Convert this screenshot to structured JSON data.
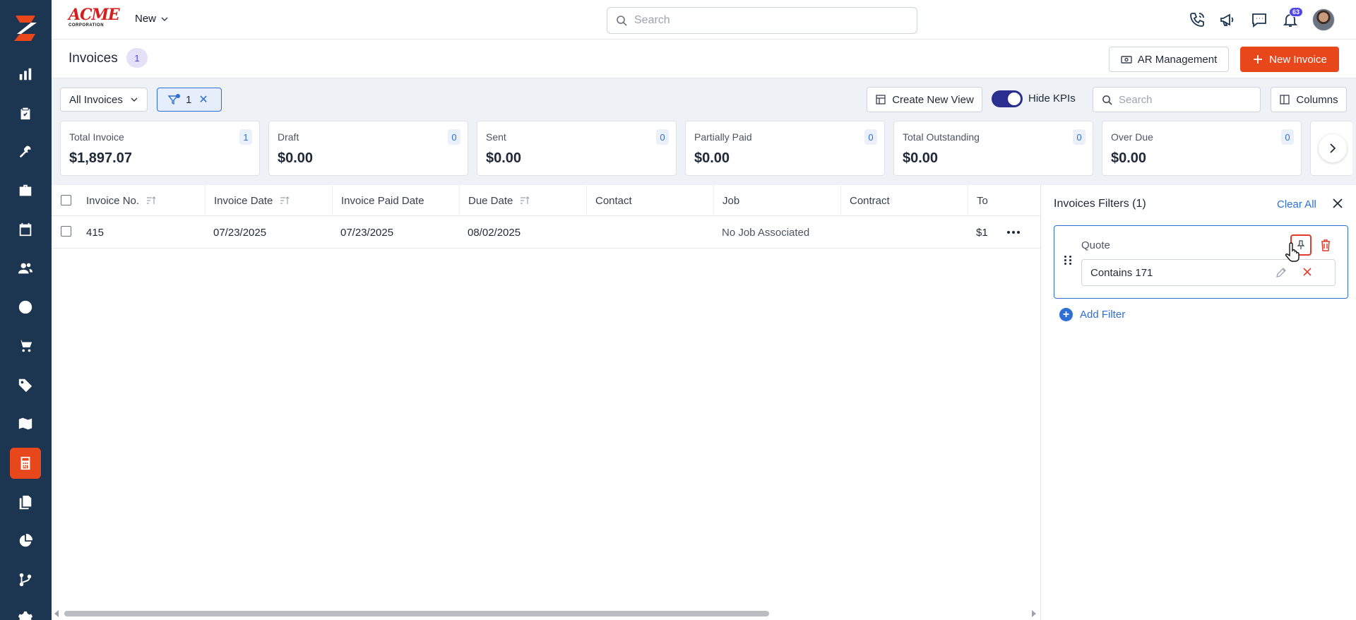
{
  "brand": {
    "name": "ACME",
    "sub": "CORPORATION"
  },
  "topbar": {
    "new_label": "New",
    "search_placeholder": "Search",
    "notifications_count": "63"
  },
  "page": {
    "title": "Invoices",
    "count": "1",
    "ar_button": "AR Management",
    "new_invoice_button": "New Invoice"
  },
  "toolbar": {
    "view_select": "All Invoices",
    "filter_count": "1",
    "create_view": "Create New View",
    "hide_kpis_label": "Hide KPIs",
    "hide_kpis_on": true,
    "search_placeholder": "Search",
    "columns_label": "Columns"
  },
  "kpis": [
    {
      "label": "Total Invoice",
      "value": "$1,897.07",
      "count": "1"
    },
    {
      "label": "Draft",
      "value": "$0.00",
      "count": "0"
    },
    {
      "label": "Sent",
      "value": "$0.00",
      "count": "0"
    },
    {
      "label": "Partially Paid",
      "value": "$0.00",
      "count": "0"
    },
    {
      "label": "Total Outstanding",
      "value": "$0.00",
      "count": "0"
    },
    {
      "label": "Over Due",
      "value": "$0.00",
      "count": "0"
    }
  ],
  "table": {
    "columns": [
      "Invoice No.",
      "Invoice Date",
      "Invoice Paid Date",
      "Due Date",
      "Contact",
      "Job",
      "Contract",
      "To"
    ],
    "rows": [
      {
        "invoice_no": "415",
        "invoice_date": "07/23/2025",
        "paid_date": "07/23/2025",
        "due_date": "08/02/2025",
        "contact": "",
        "job": "No Job Associated",
        "contract": "",
        "total": "$1"
      }
    ]
  },
  "filters_panel": {
    "title": "Invoices Filters (1)",
    "clear_all": "Clear All",
    "filter_label": "Quote",
    "filter_value": "Contains 171",
    "add_filter": "Add Filter"
  },
  "colors": {
    "sidebar": "#1c3550",
    "accent": "#e8461b",
    "link": "#2e6fd6",
    "toggle": "#2a2f8f"
  }
}
